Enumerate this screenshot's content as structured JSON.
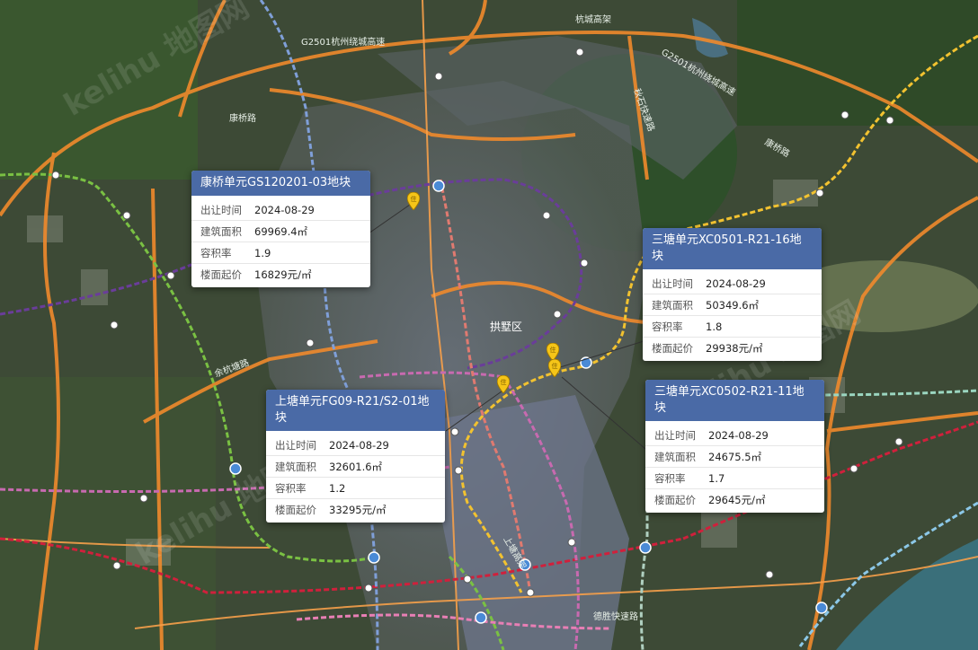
{
  "map": {
    "district_label": "拱墅区",
    "road_labels": [
      "G2501杭州绕城高速",
      "杭城高架",
      "G2501杭州绕城高速",
      "康桥路",
      "秋石快速路",
      "康桥路",
      "上塘高架",
      "德胜快速路",
      "余杭塘路"
    ],
    "watermark": "kelihu 地图网"
  },
  "parcels": [
    {
      "title": "康桥单元GS120201-03地块",
      "rows": [
        {
          "label": "出让时间",
          "value": "2024-08-29"
        },
        {
          "label": "建筑面积",
          "value": "69969.4㎡"
        },
        {
          "label": "容积率",
          "value": "1.9"
        },
        {
          "label": "楼面起价",
          "value": "16829元/㎡"
        }
      ]
    },
    {
      "title": "三塘单元XC0501-R21-16地块",
      "rows": [
        {
          "label": "出让时间",
          "value": "2024-08-29"
        },
        {
          "label": "建筑面积",
          "value": "50349.6㎡"
        },
        {
          "label": "容积率",
          "value": "1.8"
        },
        {
          "label": "楼面起价",
          "value": "29938元/㎡"
        }
      ]
    },
    {
      "title": "上塘单元FG09-R21/S2-01地块",
      "rows": [
        {
          "label": "出让时间",
          "value": "2024-08-29"
        },
        {
          "label": "建筑面积",
          "value": "32601.6㎡"
        },
        {
          "label": "容积率",
          "value": "1.2"
        },
        {
          "label": "楼面起价",
          "value": "33295元/㎡"
        }
      ]
    },
    {
      "title": "三塘单元XC0502-R21-11地块",
      "rows": [
        {
          "label": "出让时间",
          "value": "2024-08-29"
        },
        {
          "label": "建筑面积",
          "value": "24675.5㎡"
        },
        {
          "label": "容积率",
          "value": "1.7"
        },
        {
          "label": "楼面起价",
          "value": "29645元/㎡"
        }
      ]
    }
  ],
  "colors": {
    "card_header": "#4a6aa6",
    "expressway": "#f08a2c",
    "metro_purple": "#6a3d9a",
    "metro_green": "#7ac143",
    "metro_yellow": "#f2c230",
    "metro_red": "#d0203c",
    "metro_pink": "#c86ab0",
    "metro_lightblue": "#8cc8e8",
    "marker": "#f5c518"
  }
}
